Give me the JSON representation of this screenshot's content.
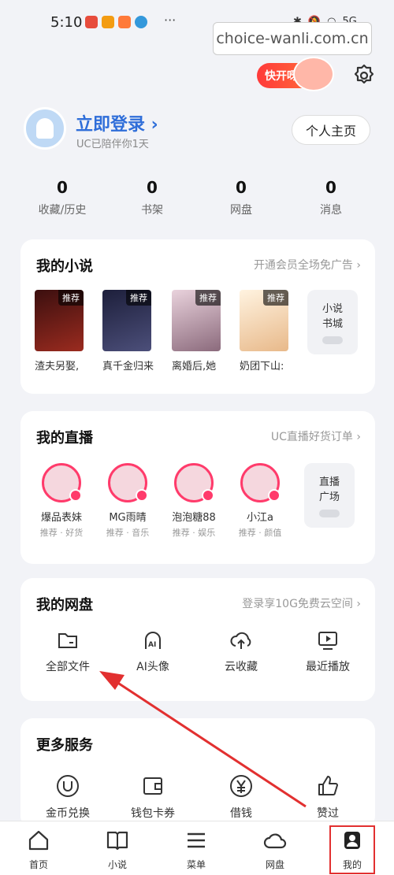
{
  "status": {
    "time": "5:10",
    "dots": "···",
    "signal": "5G"
  },
  "watermark": "choice-wanli.com.cn",
  "promo": {
    "label": "快开呀"
  },
  "profile": {
    "login": "立即登录",
    "sub": "UC已陪伴你1天",
    "home_button": "个人主页"
  },
  "stats": [
    {
      "value": "0",
      "label": "收藏/历史"
    },
    {
      "value": "0",
      "label": "书架"
    },
    {
      "value": "0",
      "label": "网盘"
    },
    {
      "value": "0",
      "label": "消息"
    }
  ],
  "novels": {
    "title": "我的小说",
    "link": "开通会员全场免广告",
    "tag": "推荐",
    "books": [
      {
        "title": "渣夫另娶,",
        "color": "#6b1f1f"
      },
      {
        "title": "真千金归来",
        "color": "#2b2d4f"
      },
      {
        "title": "离婚后,她",
        "color": "#c9a7b8"
      },
      {
        "title": "奶团下山:",
        "color": "#f4e0c8"
      }
    ],
    "more": {
      "line1": "小说",
      "line2": "书城"
    }
  },
  "live": {
    "title": "我的直播",
    "link": "UC直播好货订单",
    "streamers": [
      {
        "name": "爆品表妹",
        "sub": "推荐 · 好货"
      },
      {
        "name": "MG雨晴",
        "sub": "推荐 · 音乐"
      },
      {
        "name": "泡泡糖88",
        "sub": "推荐 · 娱乐"
      },
      {
        "name": "小江a",
        "sub": "推荐 · 颜值"
      }
    ],
    "more": {
      "line1": "直播",
      "line2": "广场"
    }
  },
  "disk": {
    "title": "我的网盘",
    "link": "登录享10G免费云空间",
    "tools": [
      {
        "label": "全部文件",
        "icon": "folder-icon"
      },
      {
        "label": "AI头像",
        "icon": "ai-avatar-icon"
      },
      {
        "label": "云收藏",
        "icon": "cloud-upload-icon"
      },
      {
        "label": "最近播放",
        "icon": "play-screen-icon"
      }
    ]
  },
  "services": {
    "title": "更多服务",
    "items": [
      {
        "label": "金币兑换",
        "icon": "coin-icon"
      },
      {
        "label": "钱包卡券",
        "icon": "wallet-icon"
      },
      {
        "label": "借钱",
        "icon": "yuan-icon"
      },
      {
        "label": "赞过",
        "icon": "thumbs-up-icon"
      }
    ]
  },
  "nav": [
    {
      "label": "首页",
      "icon": "home-icon"
    },
    {
      "label": "小说",
      "icon": "book-icon"
    },
    {
      "label": "菜单",
      "icon": "menu-icon"
    },
    {
      "label": "网盘",
      "icon": "cloud-icon"
    },
    {
      "label": "我的",
      "icon": "profile-icon"
    }
  ],
  "colors": {
    "accent": "#2f6ed9",
    "live": "#ff3b6b",
    "annotation": "#e23030"
  }
}
